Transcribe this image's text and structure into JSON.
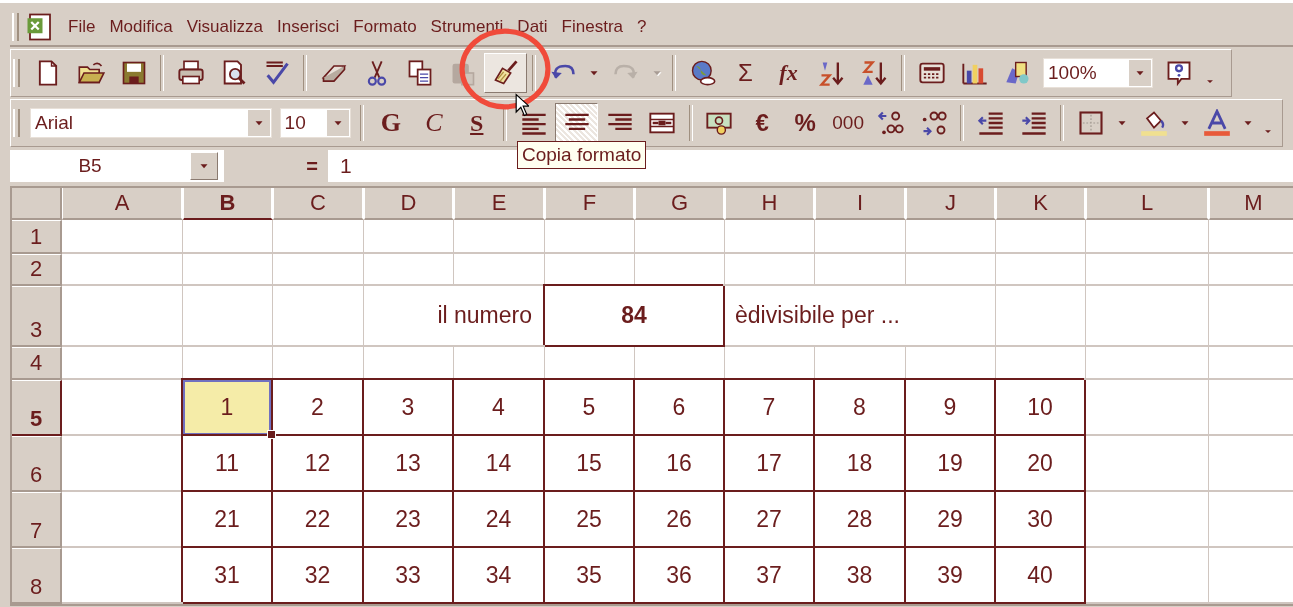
{
  "menu": {
    "items": [
      {
        "label": "File"
      },
      {
        "label": "Modifica"
      },
      {
        "label": "Visualizza"
      },
      {
        "label": "Inserisci"
      },
      {
        "label": "Formato"
      },
      {
        "label": "Strumenti"
      },
      {
        "label": "Dati"
      },
      {
        "label": "Finestra"
      },
      {
        "label": "?"
      }
    ]
  },
  "standard_toolbar": {
    "groups": [
      [
        {
          "kind": "icon",
          "pressed": false,
          "disabled": false
        },
        {
          "kind": "icon",
          "pressed": false,
          "disabled": false
        },
        {
          "kind": "icon",
          "pressed": false,
          "disabled": false
        }
      ],
      [
        {
          "kind": "icon",
          "pressed": false,
          "disabled": false
        },
        {
          "kind": "icon",
          "pressed": false,
          "disabled": false
        },
        {
          "kind": "icon",
          "pressed": false,
          "disabled": false
        }
      ],
      [
        {
          "kind": "icon",
          "pressed": false,
          "disabled": false
        },
        {
          "kind": "icon",
          "pressed": false,
          "disabled": false
        },
        {
          "kind": "icon",
          "pressed": false,
          "disabled": false
        },
        {
          "kind": "icon",
          "pressed": false,
          "disabled": true
        },
        {
          "kind": "icon",
          "pressed": true,
          "disabled": false
        }
      ],
      [
        {
          "kind": "icon",
          "pressed": false,
          "disabled": false
        },
        {
          "kind": "arrow"
        },
        {
          "kind": "icon",
          "pressed": false,
          "disabled": true
        },
        {
          "kind": "arrow"
        }
      ],
      [
        {
          "kind": "icon",
          "pressed": false,
          "disabled": false
        },
        {
          "kind": "glyph",
          "label": "Σ"
        },
        {
          "kind": "glyph",
          "label": "fx"
        },
        {
          "kind": "icon",
          "pressed": false,
          "disabled": false
        },
        {
          "kind": "icon",
          "pressed": false,
          "disabled": false
        }
      ],
      [
        {
          "kind": "icon",
          "pressed": false,
          "disabled": false
        },
        {
          "kind": "icon",
          "pressed": false,
          "disabled": false
        },
        {
          "kind": "icon",
          "pressed": false,
          "disabled": false
        },
        {
          "kind": "combo",
          "value": "100%"
        },
        {
          "kind": "icon",
          "pressed": false,
          "disabled": false
        },
        {
          "kind": "more"
        }
      ]
    ]
  },
  "formatting_toolbar": {
    "groups": [
      [
        {
          "kind": "combo",
          "value": "Arial"
        },
        {
          "kind": "combo",
          "value": "10"
        }
      ],
      [
        {
          "kind": "glyph",
          "label": "G"
        },
        {
          "kind": "glyph",
          "label": "C"
        },
        {
          "kind": "glyph",
          "label": "S"
        }
      ],
      [
        {
          "kind": "icon",
          "pressed": false,
          "disabled": false
        },
        {
          "kind": "icon",
          "pressed": true,
          "disabled": false
        },
        {
          "kind": "icon",
          "pressed": false,
          "disabled": false
        },
        {
          "kind": "icon",
          "pressed": false,
          "disabled": false
        }
      ],
      [
        {
          "kind": "icon",
          "pressed": false,
          "disabled": false
        },
        {
          "kind": "glyph",
          "label": "€"
        },
        {
          "kind": "glyph",
          "label": "%"
        },
        {
          "kind": "glyph",
          "label": "000"
        },
        {
          "kind": "icon",
          "pressed": false,
          "disabled": false
        },
        {
          "kind": "icon",
          "pressed": false,
          "disabled": false
        }
      ],
      [
        {
          "kind": "icon",
          "pressed": false,
          "disabled": false
        },
        {
          "kind": "icon",
          "pressed": false,
          "disabled": false
        }
      ],
      [
        {
          "kind": "icon",
          "pressed": false,
          "disabled": false
        },
        {
          "kind": "arrow"
        },
        {
          "kind": "icon",
          "pressed": false,
          "disabled": false
        },
        {
          "kind": "arrow"
        },
        {
          "kind": "icon",
          "pressed": false,
          "disabled": false
        },
        {
          "kind": "arrow"
        },
        {
          "kind": "more"
        }
      ]
    ]
  },
  "tooltip": {
    "text": "Copia formato"
  },
  "formula_bar": {
    "name_box": "B5",
    "equals": "=",
    "value": "1"
  },
  "columns": [
    {
      "label": "A",
      "selected": false
    },
    {
      "label": "B",
      "selected": true
    },
    {
      "label": "C",
      "selected": false
    },
    {
      "label": "D",
      "selected": false
    },
    {
      "label": "E",
      "selected": false
    },
    {
      "label": "F",
      "selected": false
    },
    {
      "label": "G",
      "selected": false
    },
    {
      "label": "H",
      "selected": false
    },
    {
      "label": "I",
      "selected": false
    },
    {
      "label": "J",
      "selected": false
    },
    {
      "label": "K",
      "selected": false
    },
    {
      "label": "L",
      "selected": false
    },
    {
      "label": "M",
      "selected": false
    }
  ],
  "rows": [
    {
      "label": "1",
      "selected": false
    },
    {
      "label": "2",
      "selected": false
    },
    {
      "label": "3",
      "selected": false
    },
    {
      "label": "4",
      "selected": false
    },
    {
      "label": "5",
      "selected": true
    },
    {
      "label": "6",
      "selected": false
    },
    {
      "label": "7",
      "selected": false
    },
    {
      "label": "8",
      "selected": false
    }
  ],
  "prompt": {
    "label": "il numero",
    "value": "84",
    "suffix": "èdivisibile per ..."
  },
  "number_table": {
    "rows": [
      [
        {
          "text": "1",
          "selected": true
        },
        {
          "text": "2",
          "selected": false
        },
        {
          "text": "3",
          "selected": false
        },
        {
          "text": "4",
          "selected": false
        },
        {
          "text": "5",
          "selected": false
        },
        {
          "text": "6",
          "selected": false
        },
        {
          "text": "7",
          "selected": false
        },
        {
          "text": "8",
          "selected": false
        },
        {
          "text": "9",
          "selected": false
        },
        {
          "text": "10",
          "selected": false
        }
      ],
      [
        {
          "text": "11",
          "selected": false
        },
        {
          "text": "12",
          "selected": false
        },
        {
          "text": "13",
          "selected": false
        },
        {
          "text": "14",
          "selected": false
        },
        {
          "text": "15",
          "selected": false
        },
        {
          "text": "16",
          "selected": false
        },
        {
          "text": "17",
          "selected": false
        },
        {
          "text": "18",
          "selected": false
        },
        {
          "text": "19",
          "selected": false
        },
        {
          "text": "20",
          "selected": false
        }
      ],
      [
        {
          "text": "21",
          "selected": false
        },
        {
          "text": "22",
          "selected": false
        },
        {
          "text": "23",
          "selected": false
        },
        {
          "text": "24",
          "selected": false
        },
        {
          "text": "25",
          "selected": false
        },
        {
          "text": "26",
          "selected": false
        },
        {
          "text": "27",
          "selected": false
        },
        {
          "text": "28",
          "selected": false
        },
        {
          "text": "29",
          "selected": false
        },
        {
          "text": "30",
          "selected": false
        }
      ],
      [
        {
          "text": "31",
          "selected": false
        },
        {
          "text": "32",
          "selected": false
        },
        {
          "text": "33",
          "selected": false
        },
        {
          "text": "34",
          "selected": false
        },
        {
          "text": "35",
          "selected": false
        },
        {
          "text": "36",
          "selected": false
        },
        {
          "text": "37",
          "selected": false
        },
        {
          "text": "38",
          "selected": false
        },
        {
          "text": "39",
          "selected": false
        },
        {
          "text": "40",
          "selected": false
        }
      ]
    ]
  }
}
